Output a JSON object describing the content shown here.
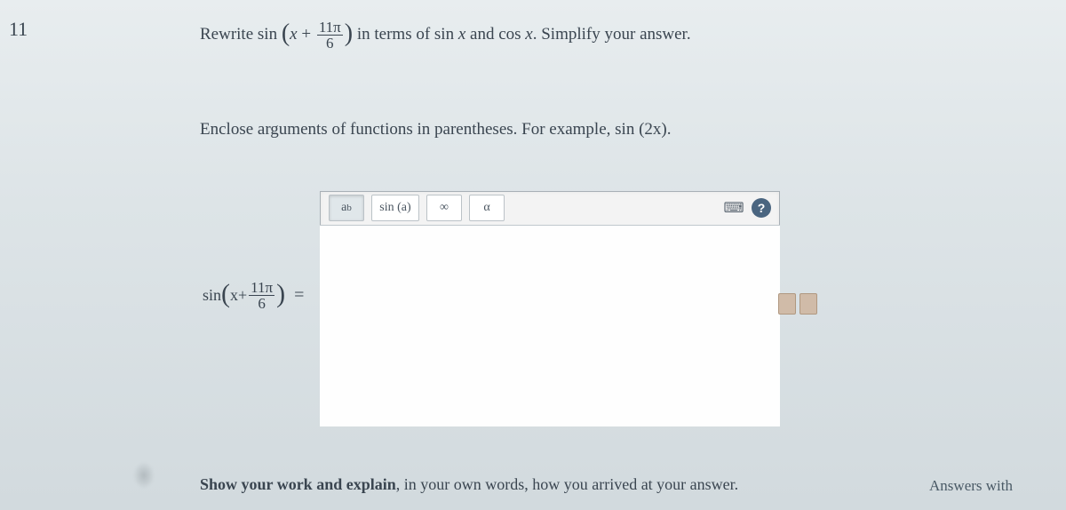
{
  "question_number": "11",
  "prompt": {
    "prefix": "Rewrite sin",
    "lparen": "(",
    "arg_x": "x",
    "plus": " + ",
    "frac_num": "11π",
    "frac_den": "6",
    "rparen": ")",
    "middle": " in terms of sin ",
    "var1": "x",
    "and": " and cos ",
    "var2": "x",
    "suffix": ". Simplify your answer."
  },
  "instruction": {
    "text1": "Enclose arguments of functions in parentheses. For example, sin ",
    "example_l": "(",
    "example_arg": "2x",
    "example_r": ").",
    "period": ""
  },
  "toolbar": {
    "exponent": "a",
    "exponent_sup": "b",
    "func": "sin (a)",
    "infinity": "∞",
    "alpha": "α",
    "keyboard": "⌨",
    "help": "?"
  },
  "expression": {
    "sin": "sin",
    "lparen": "(",
    "x": "x",
    "plus": " + ",
    "frac_num": "11π",
    "frac_den": "6",
    "rparen": ")",
    "equals": "="
  },
  "show_work": {
    "bold": "Show your work and explain",
    "rest": ", in your own words, how you arrived at your answer."
  },
  "answers_cut": "Answers with"
}
